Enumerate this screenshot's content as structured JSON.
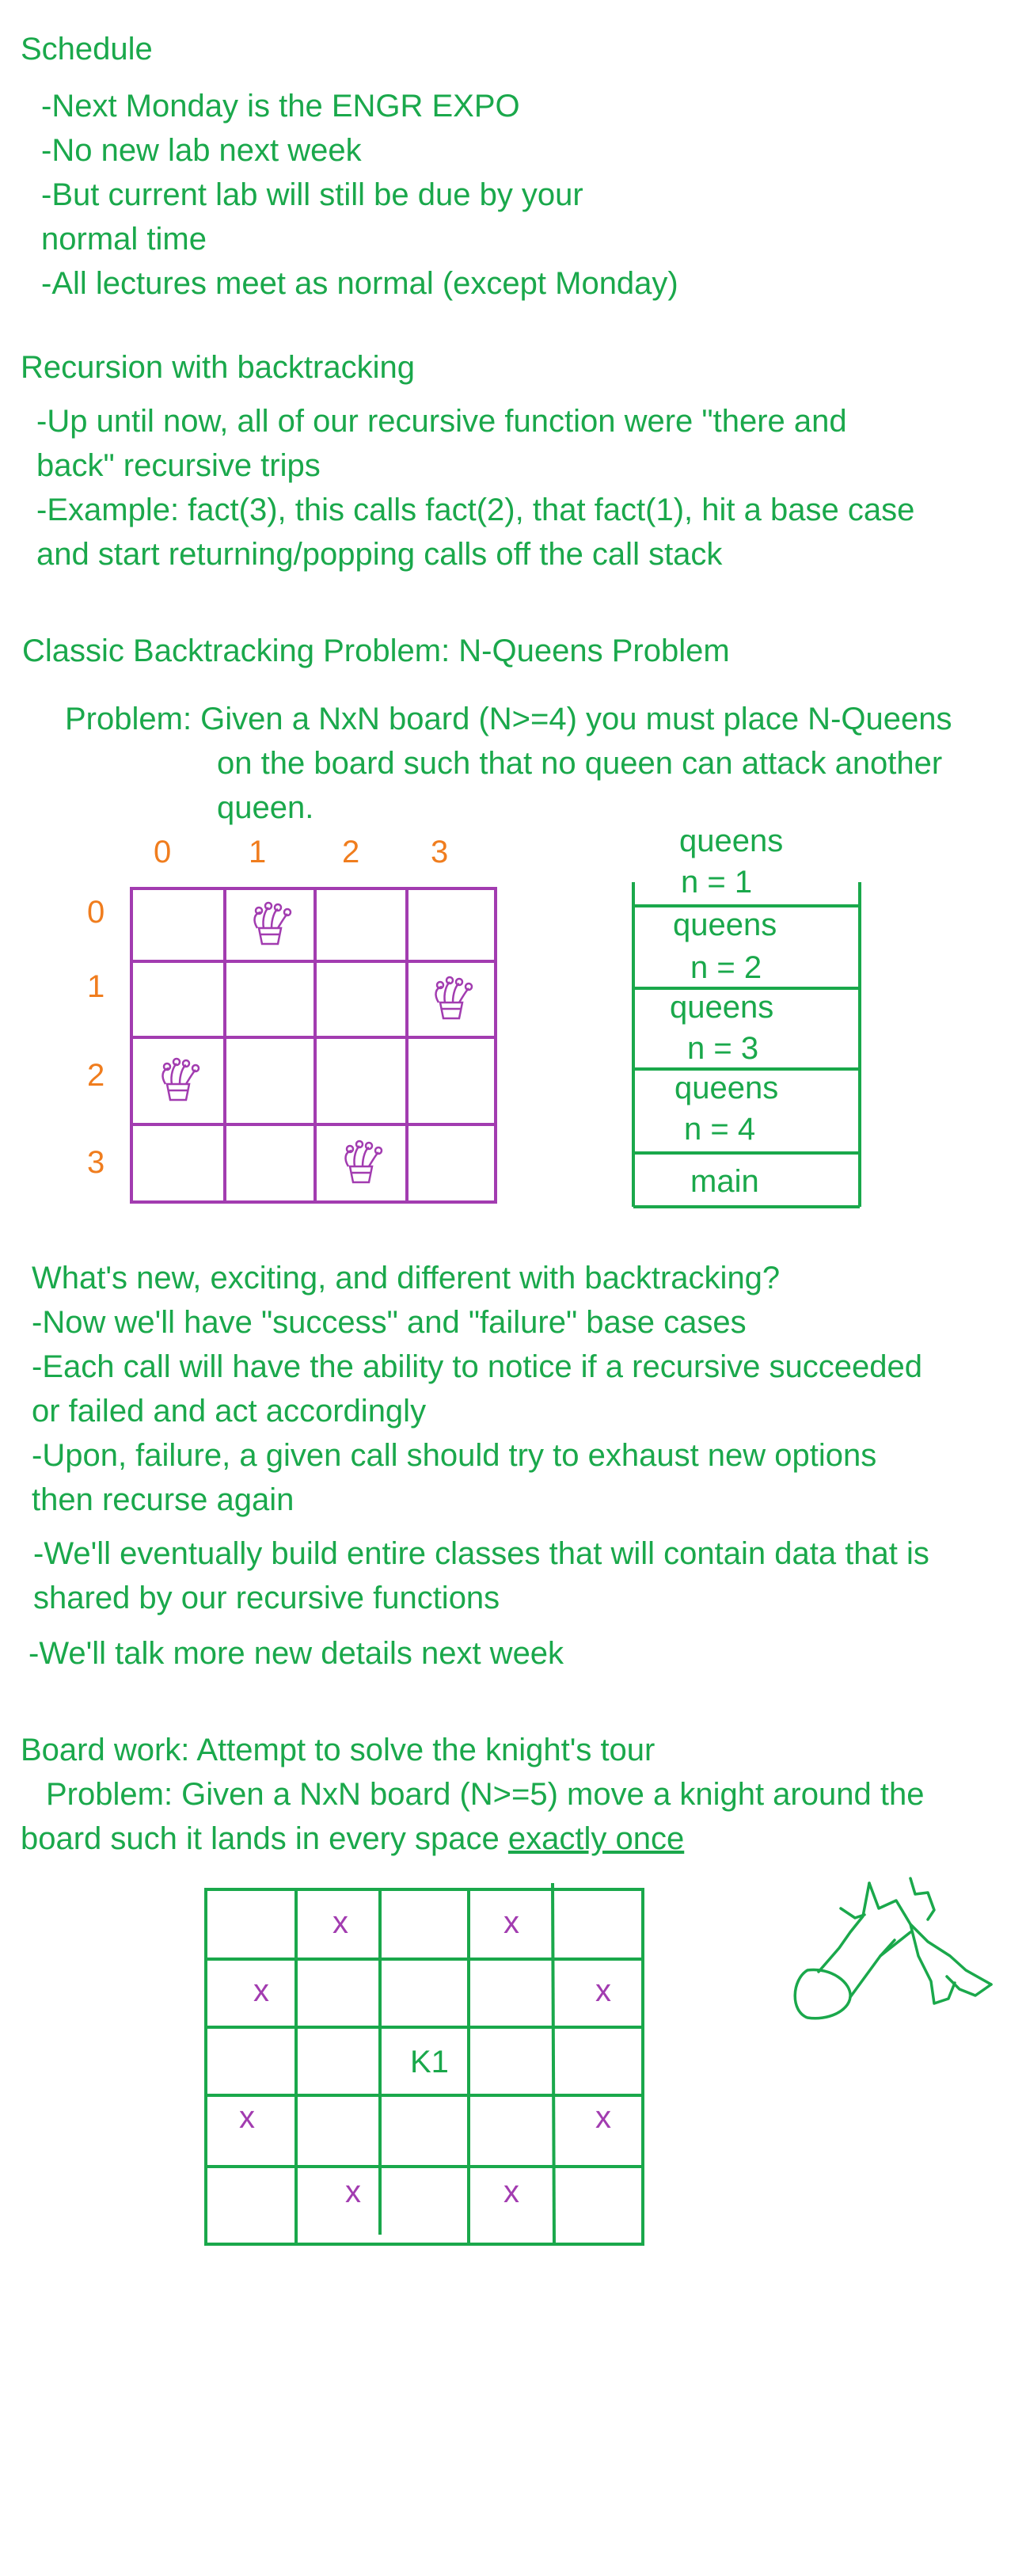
{
  "schedule": {
    "heading": "Schedule",
    "lines": [
      "-Next Monday is the ENGR EXPO",
      "-No new lab next week",
      "-But current lab will still be due by your",
      "normal time",
      "-All lectures meet as normal (except Monday)"
    ]
  },
  "recursion": {
    "heading": "Recursion with backtracking",
    "lines": [
      "-Up until now, all of our recursive function were \"there and",
      "back\" recursive trips",
      "-Example: fact(3), this calls fact(2), that fact(1), hit a base case",
      "and start returning/popping calls off the call stack"
    ]
  },
  "nqueens": {
    "heading": "Classic Backtracking Problem: N-Queens Problem",
    "problem_lines": [
      "Problem: Given a NxN board (N>=4) you must place N-Queens",
      "on the board such that no queen can attack another",
      "queen."
    ],
    "col_labels": [
      "0",
      "1",
      "2",
      "3"
    ],
    "row_labels": [
      "0",
      "1",
      "2",
      "3"
    ],
    "queen_positions": [
      [
        0,
        1
      ],
      [
        1,
        3
      ],
      [
        2,
        0
      ],
      [
        3,
        2
      ]
    ],
    "call_stack": [
      {
        "name": "queens",
        "arg": "n = 1"
      },
      {
        "name": "queens",
        "arg": "n = 2"
      },
      {
        "name": "queens",
        "arg": "n = 3"
      },
      {
        "name": "queens",
        "arg": "n = 4"
      },
      {
        "name": "main",
        "arg": ""
      }
    ]
  },
  "whats_new": {
    "lines": [
      "What's new, exciting, and different with backtracking?",
      "-Now we'll have \"success\" and \"failure\" base cases",
      "-Each call will have the ability to notice if a recursive succeeded",
      "or failed and act accordingly",
      "-Upon, failure, a given call should try to exhaust new options",
      "then recurse again",
      "-We'll eventually build entire classes that will contain data that is",
      "shared by our recursive functions",
      "-We'll talk more new details next week"
    ]
  },
  "knights": {
    "heading": "Board work: Attempt to solve the knight's tour",
    "problem_line1": "Problem: Given a NxN board (N>=5) move a knight around the",
    "problem_line2_prefix": "board such it lands in every space ",
    "problem_line2_underlined": "exactly once",
    "knight_label": "K1",
    "move_mark": "x"
  },
  "colors": {
    "green": "#1aa84b",
    "orange": "#f07d1e",
    "purple": "#a23cb0"
  }
}
